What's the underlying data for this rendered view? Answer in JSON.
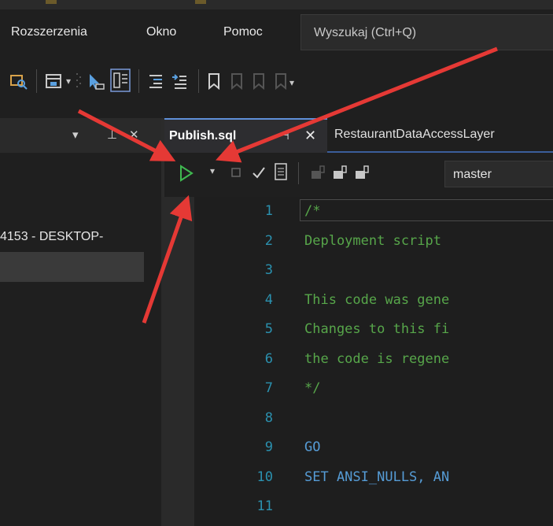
{
  "menu": {
    "items": [
      "Rozszerzenia",
      "Okno",
      "Pomoc"
    ],
    "search_placeholder": "Wyszukaj (Ctrl+Q)"
  },
  "left_panel": {
    "server_row": "4153 - DESKTOP-",
    "pin_glyph": "▾  ⭳  ✕"
  },
  "tabs": [
    {
      "label": "Publish.sql",
      "active": true
    },
    {
      "label": "RestaurantDataAccessLayer",
      "active": false
    }
  ],
  "sql_toolbar": {
    "database": "master",
    "icons": [
      "execute-icon",
      "dropdown-icon",
      "stop-icon",
      "parse-icon",
      "results-icon",
      "connect-icon",
      "disconnect-icon",
      "change-connection-icon"
    ]
  },
  "editor": {
    "lines": [
      {
        "n": "1",
        "text": "/*",
        "kind": "comment"
      },
      {
        "n": "2",
        "text": "Deployment script",
        "kind": "comment"
      },
      {
        "n": "3",
        "text": "",
        "kind": "comment"
      },
      {
        "n": "4",
        "text": "This code was gene",
        "kind": "comment"
      },
      {
        "n": "5",
        "text": "Changes to this fi",
        "kind": "comment"
      },
      {
        "n": "6",
        "text": "the code is regene",
        "kind": "comment"
      },
      {
        "n": "7",
        "text": "*/",
        "kind": "comment"
      },
      {
        "n": "8",
        "text": "",
        "kind": "comment"
      },
      {
        "n": "9",
        "text": "GO",
        "kind": "keyword"
      },
      {
        "n": "10",
        "text": "SET ANSI_NULLS, AN",
        "kind": "keyword"
      },
      {
        "n": "11",
        "text": "",
        "kind": "comment"
      }
    ]
  },
  "annotation": {
    "arrow_color": "#e53935"
  },
  "colors": {
    "accent": "#5f8fd8",
    "run_green": "#3fb950"
  }
}
